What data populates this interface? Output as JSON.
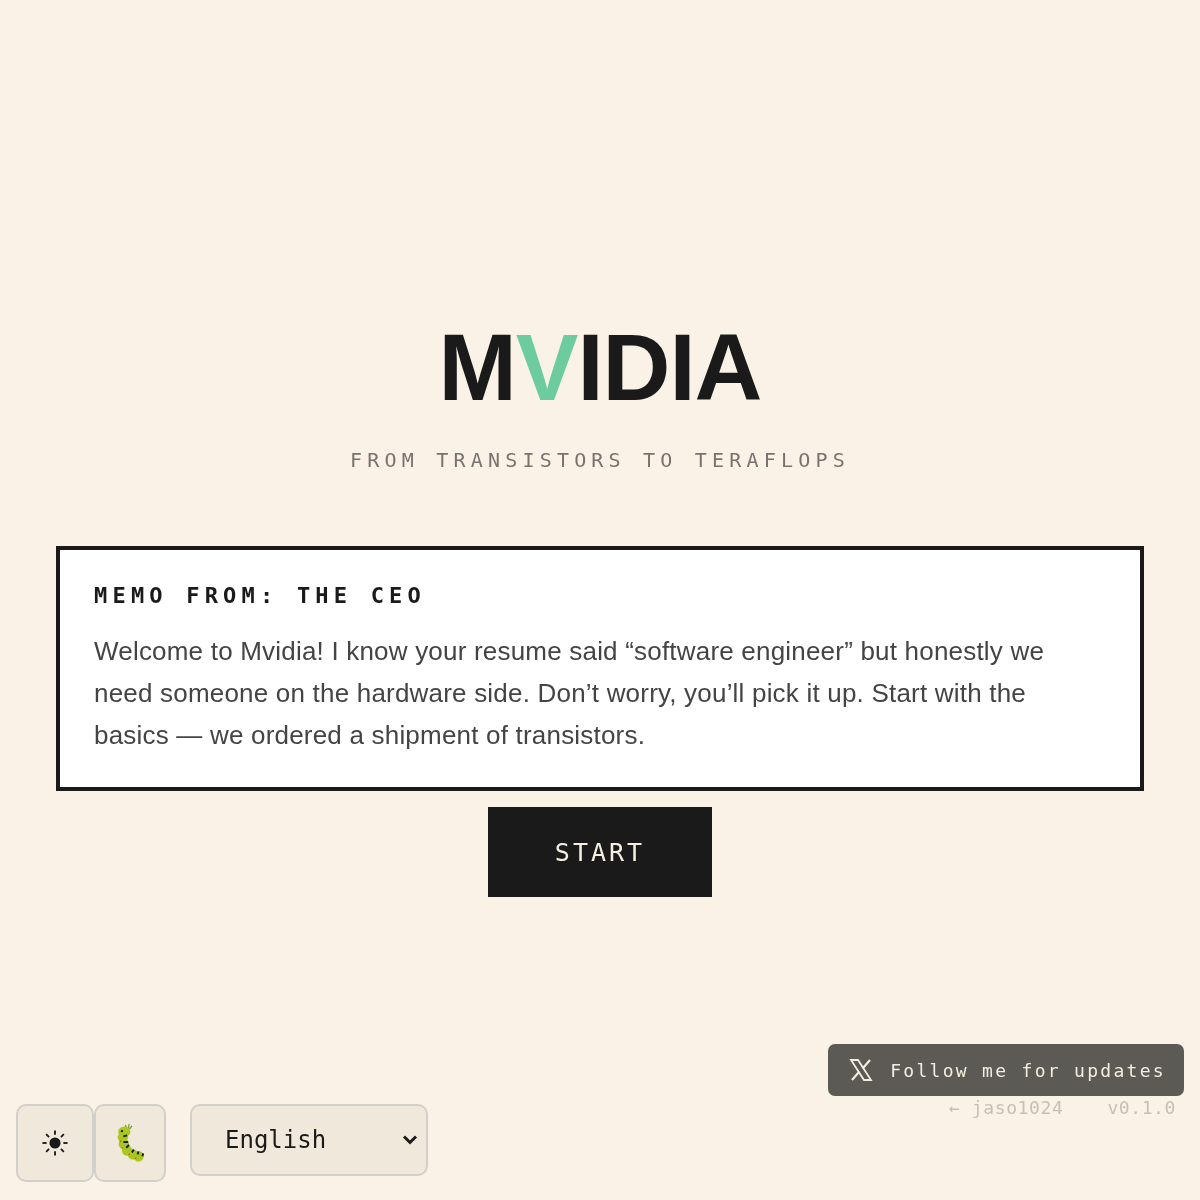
{
  "logo": [
    {
      "text": "M",
      "accent": false
    },
    {
      "text": "V",
      "accent": true
    },
    {
      "text": "IDIA",
      "accent": false
    }
  ],
  "tagline": "FROM TRANSISTORS TO TERAFLOPS",
  "memo": {
    "title": "MEMO FROM: THE CEO",
    "body": "Welcome to Mvidia! I know your resume said “software engineer” but honestly we need someone on the hardware side. Don’t worry, you’ll pick it up. Start with the basics — we ordered a shipment of transistors."
  },
  "start_button": {
    "label": "START"
  },
  "follow_button": {
    "label": "Follow me for updates"
  },
  "footer": {
    "author_link": "← jaso1024",
    "version": "v0.1.0"
  },
  "toolbar": {
    "buttons": [
      {
        "kind": "theme"
      },
      {
        "kind": "bug"
      }
    ],
    "language": {
      "value": "English"
    }
  }
}
